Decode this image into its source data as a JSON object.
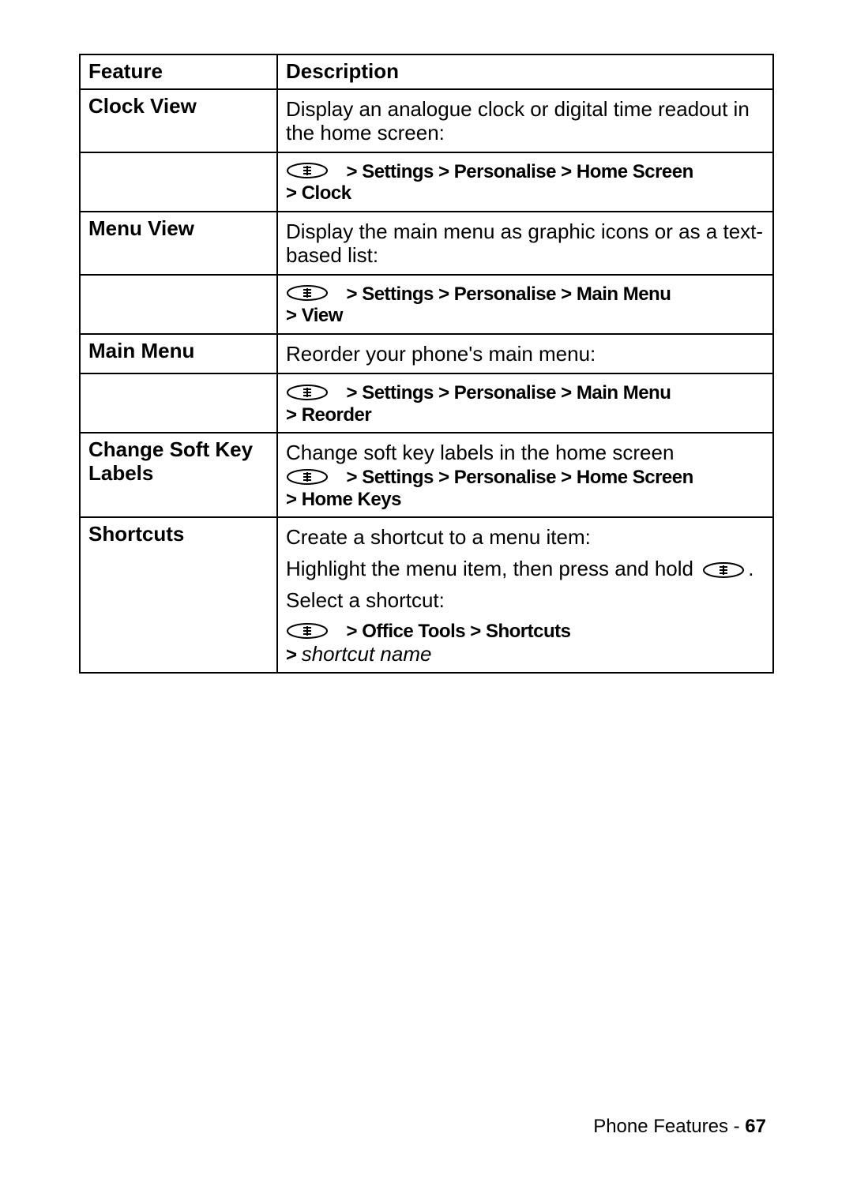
{
  "table": {
    "headers": {
      "feature": "Feature",
      "description": "Description"
    },
    "sep": ">"
  },
  "rows": {
    "clock": {
      "feature": "Clock View",
      "desc": "Display an analogue clock or digital time readout in the home screen:",
      "nav1": "Settings",
      "nav2": "Personalise",
      "nav3": "Home Screen",
      "nav4": "Clock"
    },
    "menuview": {
      "feature": "Menu View",
      "desc": "Display the main menu as graphic icons or as a text-based list:",
      "nav1": "Settings",
      "nav2": "Personalise",
      "nav3": "Main Menu",
      "nav4": "View"
    },
    "mainmenu": {
      "feature": "Main Menu",
      "desc": "Reorder your phone's main menu:",
      "nav1": "Settings",
      "nav2": "Personalise",
      "nav3": "Main Menu",
      "nav4": "Reorder"
    },
    "softkey": {
      "feature": "Change Soft Key Labels",
      "desc": "Change soft key labels in the home screen",
      "nav1": "Settings",
      "nav2": "Personalise",
      "nav3": "Home Screen",
      "nav4": "Home Keys"
    },
    "shortcuts": {
      "feature": "Shortcuts",
      "desc1": "Create a shortcut to a menu item:",
      "desc2a": "Highlight the menu item, then press and hold",
      "desc2b": ".",
      "desc3": "Select a shortcut:",
      "nav1": "Office Tools",
      "nav2": "Shortcuts",
      "nav3": "shortcut name"
    }
  },
  "footer": {
    "label": "Phone Features",
    "sep": " - ",
    "page": "67"
  }
}
